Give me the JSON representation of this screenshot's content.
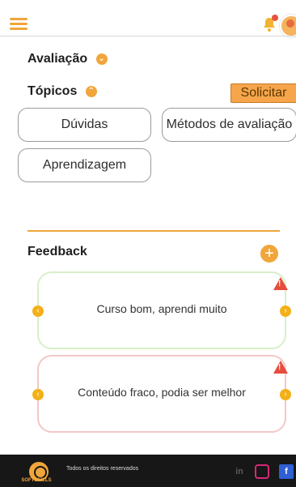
{
  "header": {
    "menu_icon": "menu-icon",
    "bell_icon": "bell-icon",
    "avatar": "avatar"
  },
  "evaluation": {
    "title": "Avaliação"
  },
  "topics": {
    "title": "Tópicos",
    "request_button": "Solicitar",
    "buttons": [
      "Dúvidas",
      "Métodos de avaliação",
      "Aprendizagem"
    ]
  },
  "feedback": {
    "title": "Feedback",
    "items": [
      {
        "text": "Curso bom, aprendi muito"
      },
      {
        "text": "Conteúdo fraco, podia ser melhor"
      }
    ]
  },
  "footer": {
    "brand": "SOFTSKILLS",
    "rights": "Todos os direitos reservados",
    "social": {
      "linkedin": "in",
      "instagram": "",
      "facebook": "f"
    }
  },
  "colors": {
    "accent": "#f0a63b",
    "warning": "#e74c3c",
    "success_border": "#d8efc7",
    "danger_border": "#f3c7c7",
    "footer_bg": "#171717"
  }
}
